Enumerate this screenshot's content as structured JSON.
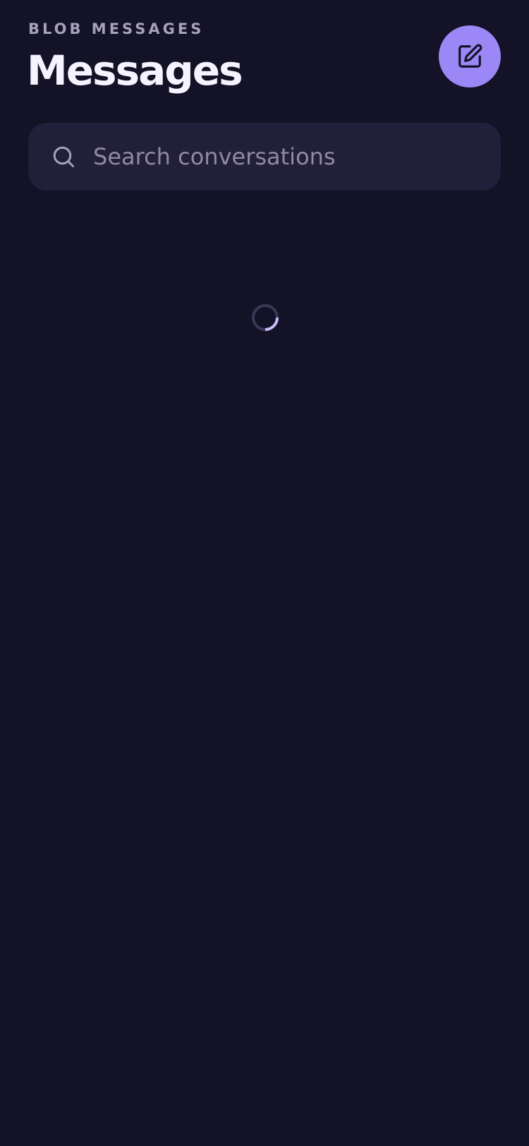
{
  "header": {
    "eyebrow": "BLOB MESSAGES",
    "title": "Messages"
  },
  "compose": {
    "icon": "compose-edit-icon",
    "accent_color": "#9b87f5"
  },
  "search": {
    "value": "",
    "placeholder": "Search conversations",
    "icon": "search-icon"
  },
  "status": {
    "loading": true,
    "indicator": "loading-spinner"
  },
  "colors": {
    "background": "#131226",
    "surface": "#211f3a",
    "accent": "#9b87f5"
  }
}
